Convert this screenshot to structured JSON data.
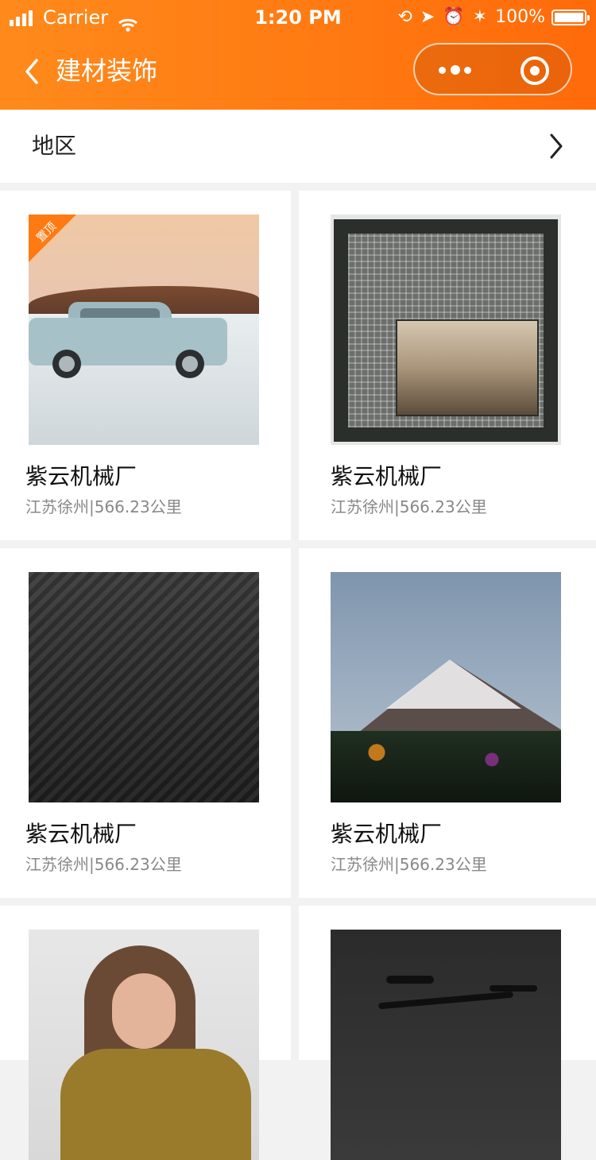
{
  "status_bar": {
    "carrier": "Carrier",
    "time": "1:20 PM",
    "battery": "100%",
    "icons": [
      "signal-icon",
      "wifi-icon",
      "screen-rotation-lock-icon",
      "location-icon",
      "alarm-icon",
      "bluetooth-icon",
      "battery-icon"
    ]
  },
  "header": {
    "title": "建材装饰",
    "back_icon": "chevron-left-icon",
    "menu_icon": "more-dots-icon",
    "close_icon": "target-icon"
  },
  "region": {
    "label": "地区",
    "chevron_icon": "chevron-right-icon"
  },
  "items": [
    {
      "name": "紫云机械厂",
      "location": "江苏徐州|566.23公里",
      "badge": "置顶"
    },
    {
      "name": "紫云机械厂",
      "location": "江苏徐州|566.23公里"
    },
    {
      "name": "紫云机械厂",
      "location": "江苏徐州|566.23公里"
    },
    {
      "name": "紫云机械厂",
      "location": "江苏徐州|566.23公里"
    },
    {
      "name": "",
      "location": ""
    },
    {
      "name": "",
      "location": ""
    }
  ],
  "colors": {
    "accent": "#ff7a12",
    "text_primary": "#111111",
    "text_secondary": "#888888",
    "background": "#f2f2f2"
  }
}
